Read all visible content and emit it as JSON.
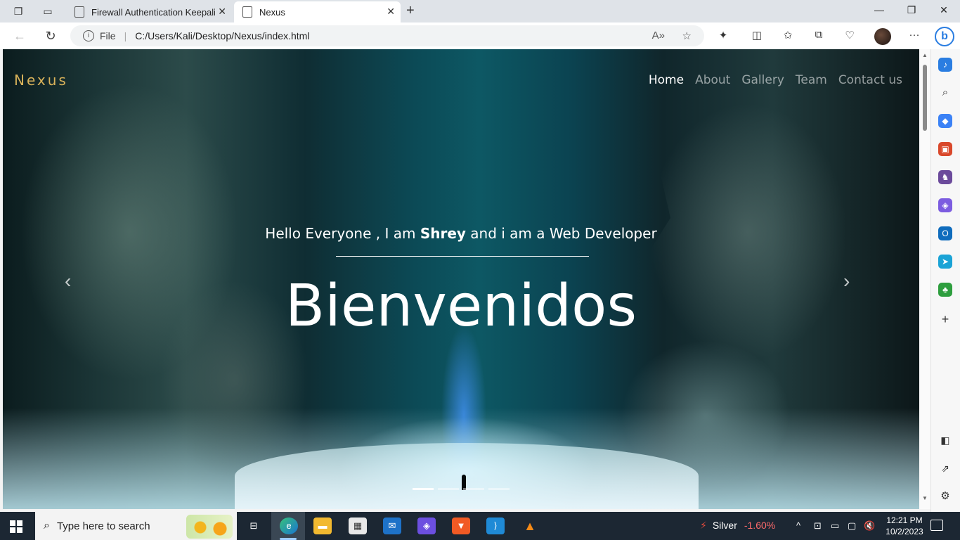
{
  "browser": {
    "tabs": [
      {
        "title": "Firewall Authentication Keepalive",
        "active": false
      },
      {
        "title": "Nexus",
        "active": true
      }
    ],
    "address": {
      "scheme_label": "File",
      "url": "C:/Users/Kali/Desktop/Nexus/index.html"
    }
  },
  "site": {
    "brand": "Nexus",
    "nav": [
      "Home",
      "About",
      "Gallery",
      "Team",
      "Contact us"
    ],
    "active_nav": "Home",
    "hero": {
      "subtitle_prefix": "Hello Everyone , I am ",
      "subtitle_name": "Shrey",
      "subtitle_suffix": " and i am a Web Developer",
      "title": "Bienvenidos"
    },
    "carousel": {
      "slides": 4,
      "active_index": 0
    },
    "colors": {
      "brand": "#d9b25a",
      "nav_active": "#ffffff"
    }
  },
  "taskbar": {
    "search_placeholder": "Type here to search",
    "stock": {
      "name": "Silver",
      "change": "-1.60%"
    },
    "time": "12:21 PM",
    "date": "10/2/2023"
  },
  "icons": {
    "sidebar": [
      "bell-icon",
      "search-icon",
      "tag-icon",
      "briefcase-icon",
      "chess-icon",
      "copilot-icon",
      "outlook-icon",
      "send-icon",
      "tree-icon",
      "add-icon",
      "split-icon",
      "external-icon",
      "settings-icon"
    ]
  }
}
